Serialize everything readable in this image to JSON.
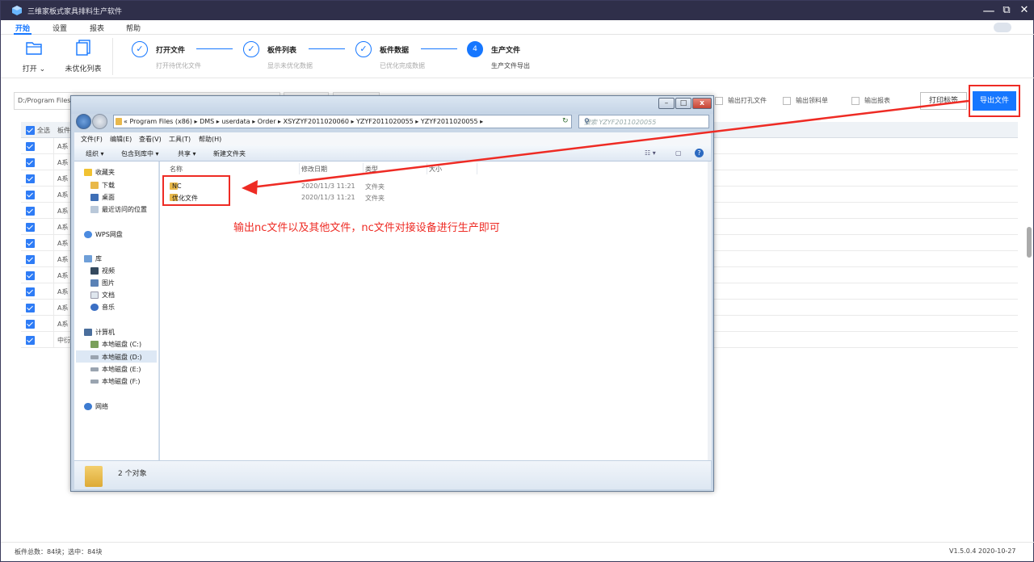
{
  "app": {
    "title": "三维家板式家具排料生产软件",
    "window_controls": {
      "minimize": "—",
      "restore": "⧉",
      "close": "✕"
    }
  },
  "menubar": {
    "items": [
      "开始",
      "设置",
      "报表",
      "帮助"
    ],
    "active": "开始"
  },
  "toolbar": {
    "open_label": "打开",
    "unoptimized_label": "未优化列表"
  },
  "steps": [
    {
      "num": "✓",
      "name": "打开文件",
      "sub": "打开待优化文件"
    },
    {
      "num": "✓",
      "name": "板件列表",
      "sub": "显示未优化数据"
    },
    {
      "num": "✓",
      "name": "板件数据",
      "sub": "已优化完成数据"
    },
    {
      "num": "4",
      "name": "生产文件",
      "sub": "生产文件导出"
    }
  ],
  "output_options": {
    "path": "D:/Program Files",
    "opt1": "输出打孔文件",
    "opt2": "输出领料单",
    "opt3": "输出报表",
    "print_label": "打印标签",
    "export_label": "导出文件"
  },
  "table": {
    "select_all": "全选",
    "col_board": "板件",
    "rows": [
      "A系",
      "A系",
      "A系",
      "A系",
      "A系",
      "A系",
      "A系",
      "A系",
      "A系",
      "A系",
      "A系",
      "A系",
      "中衍"
    ]
  },
  "explorer": {
    "breadcrumbs": "« Program Files (x86) ▸ DMS ▸ userdata ▸ Order ▸ XSYZYF2011020060 ▸ YZYF2011020055 ▸ YZYF2011020055 ▸",
    "search_placeholder": "搜索 YZYF2011020055",
    "menu": [
      "文件(F)",
      "编辑(E)",
      "查看(V)",
      "工具(T)",
      "帮助(H)"
    ],
    "commands": [
      "组织 ▾",
      "包含到库中 ▾",
      "共享 ▾",
      "新建文件夹"
    ],
    "nav": {
      "favorites": "收藏夹",
      "download": "下载",
      "desktop": "桌面",
      "recent": "最近访问的位置",
      "wps": "WPS网盘",
      "library": "库",
      "video": "视频",
      "pictures": "图片",
      "documents": "文档",
      "music": "音乐",
      "computer": "计算机",
      "disk_c": "本地磁盘 (C:)",
      "disk_d": "本地磁盘 (D:)",
      "disk_e": "本地磁盘 (E:)",
      "disk_f": "本地磁盘 (F:)",
      "network": "网络"
    },
    "columns": {
      "name": "名称",
      "date": "修改日期",
      "type": "类型",
      "size": "大小"
    },
    "files": [
      {
        "name": "NC",
        "date": "2020/11/3 11:21",
        "type": "文件夹"
      },
      {
        "name": "优化文件",
        "date": "2020/11/3 11:21",
        "type": "文件夹"
      }
    ],
    "status": "2 个对象"
  },
  "annotation": "输出nc文件以及其他文件，nc文件对接设备进行生产即可",
  "status": {
    "left": "板件总数：84块；选中：84块",
    "right": "V1.5.0.4 2020-10-27"
  },
  "colors": {
    "accent": "#1677ff",
    "titlebar": "#2f2f4a",
    "annotation_red": "#ee2b24"
  }
}
